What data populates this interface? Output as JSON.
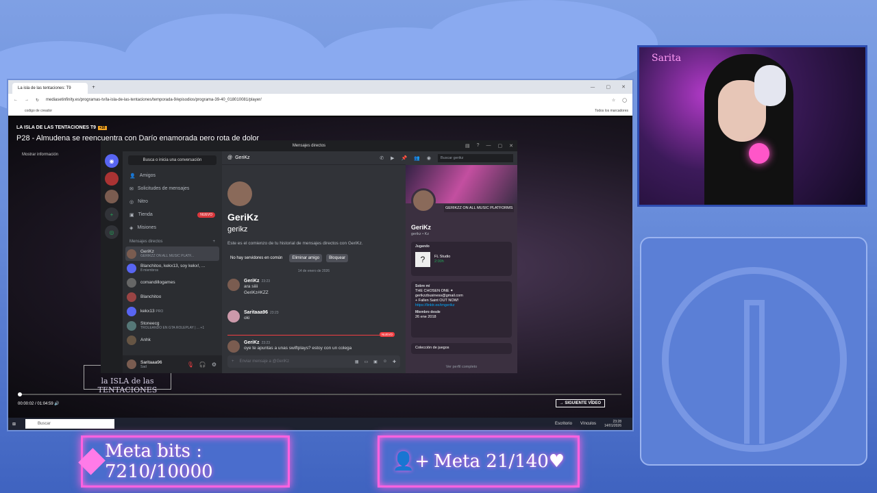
{
  "browser": {
    "tab_title": "La isla de las tentaciones: T9",
    "url": "mediasetinfinity.es/programas-tv/la-isla-de-las-tentaciones/temporada-9/episodios/programa-39-40_018010081/player/",
    "bookmark": "codigo de creador",
    "bookmarks_right": "Todos los marcadores"
  },
  "player": {
    "show": "LA ISLA DE LAS TENTACIONES T9",
    "age_badge": "+16",
    "episode": "P28 - Almudena se reencuentra con Darío enamorada pero rota de dolor",
    "more_info": "Mostrar información",
    "logo": "la ISLA de las TENTACIONES",
    "time_current": "00:00:02",
    "time_total": "01:04:59",
    "next_video": "SIGUIENTE VÍDEO",
    "progress_fraction": 0.0005
  },
  "taskbar": {
    "search": "Buscar",
    "desk": "Escritorio",
    "links": "Vínculos",
    "time": "23:28",
    "date": "14/01/2026"
  },
  "discord": {
    "window_title": "Mensajes directos",
    "search": "Busca o inicia una conversación",
    "nav": [
      {
        "label": "Amigos"
      },
      {
        "label": "Solicitudes de mensajes"
      },
      {
        "label": "Nitro"
      },
      {
        "label": "Tienda",
        "badge": "NUEVO"
      },
      {
        "label": "Misiones"
      }
    ],
    "dm_header": "Mensajes directos",
    "dms": [
      {
        "name": "GeriKz",
        "sub": "GERIKZZ ON ALL MUSIC PLATF..."
      },
      {
        "name": "Blanchitoo, kekx13, soy kekx!, ...",
        "sub": "8 miembros"
      },
      {
        "name": "comandillogames",
        "sub": ""
      },
      {
        "name": "Blanchitoo",
        "sub": ""
      },
      {
        "name": "kekx13",
        "sub": "PRO"
      },
      {
        "name": "Stoneecg",
        "sub": "TROLEANDO EN GTA ROLEPLAY | ... +1"
      },
      {
        "name": "Anhk",
        "sub": ""
      }
    ],
    "user": {
      "name": "Saritaaa96",
      "status": "Sad"
    },
    "chat": {
      "header": "GeriKz",
      "name": "GeriKz",
      "username": "gerikz",
      "intro": "Este es el comienzo de tu historial de mensajes directos con GeriKz.",
      "no_servers": "No hay servidores en común",
      "remove_friend": "Eliminar amigo",
      "block": "Bloquear",
      "date": "14 de enero de 2026",
      "messages": [
        {
          "author": "GeriKz",
          "time": "23:23",
          "lines": [
            "ara siiii",
            "GeriKz#KZZ"
          ]
        },
        {
          "author": "Saritaaa96",
          "time": "23:23",
          "lines": [
            "oki"
          ]
        },
        {
          "author": "GeriKz",
          "time": "23:23",
          "lines": [
            "oye te apuntas a unas swiftplays? estoy con un colega"
          ]
        }
      ],
      "new_label": "NUEVO",
      "composer": "Enviar mensaje a @GeriKz",
      "search": "Buscar gerikz"
    },
    "profile": {
      "status": "GERIKZZ ON ALL MUSIC PLATFORMS",
      "name": "GeriKz",
      "tag": "gerikz • Kz",
      "playing_label": "Jugando",
      "game": "FL Studio",
      "game_time": "2:00h",
      "about_label": "Sobre mí",
      "about": "THE CHOSEN ONE ✦",
      "email": "gerikzzbusiness@gmail.com",
      "release": "+ Fallen Saint OUT NOW!",
      "link": "https://linktr.ee/imgerikz",
      "member_label": "Miembro desde",
      "member_since": "26 ene 2018",
      "games_collection": "Colección de juegos",
      "view_profile": "Ver perfil completo"
    }
  },
  "overlay": {
    "cam_sign": "Sarita",
    "goal_bits": "Meta bits : 7210/10000",
    "goal_follow": "Meta 21/140♥"
  }
}
